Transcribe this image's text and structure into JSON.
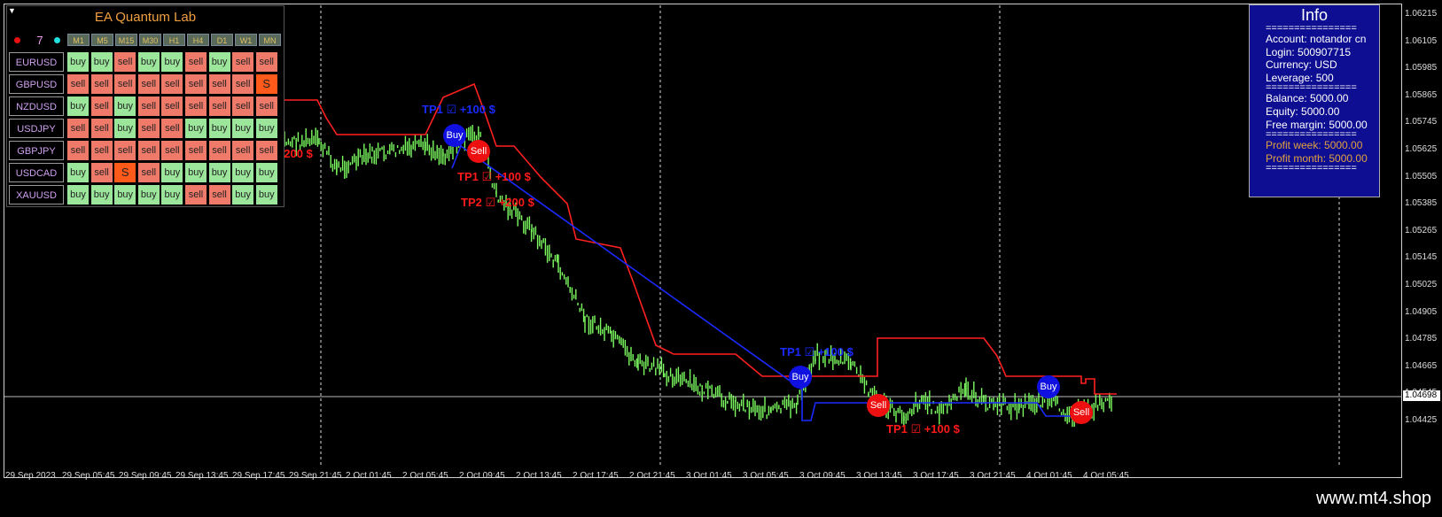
{
  "ea_panel": {
    "title": "EA Quantum Lab",
    "count": "7",
    "timeframes": [
      "M1",
      "M5",
      "M15",
      "M30",
      "H1",
      "H4",
      "D1",
      "W1",
      "MN"
    ],
    "pairs": [
      {
        "symbol": "EURUSD",
        "signals": [
          "buy",
          "buy",
          "sell",
          "buy",
          "buy",
          "sell",
          "buy",
          "sell",
          "sell"
        ]
      },
      {
        "symbol": "GBPUSD",
        "signals": [
          "sell",
          "sell",
          "sell",
          "sell",
          "sell",
          "sell",
          "sell",
          "sell",
          "S"
        ]
      },
      {
        "symbol": "NZDUSD",
        "signals": [
          "buy",
          "sell",
          "buy",
          "sell",
          "sell",
          "sell",
          "sell",
          "sell",
          "sell"
        ]
      },
      {
        "symbol": "USDJPY",
        "signals": [
          "sell",
          "sell",
          "buy",
          "sell",
          "sell",
          "buy",
          "buy",
          "buy",
          "buy"
        ]
      },
      {
        "symbol": "GBPJPY",
        "signals": [
          "sell",
          "sell",
          "sell",
          "sell",
          "sell",
          "sell",
          "sell",
          "sell",
          "sell"
        ]
      },
      {
        "symbol": "USDCAD",
        "signals": [
          "buy",
          "sell",
          "S",
          "sell",
          "buy",
          "buy",
          "buy",
          "buy",
          "buy"
        ]
      },
      {
        "symbol": "XAUUSD",
        "signals": [
          "buy",
          "buy",
          "buy",
          "buy",
          "buy",
          "sell",
          "sell",
          "buy",
          "buy"
        ]
      }
    ]
  },
  "info_panel": {
    "title": "Info",
    "separator": "================",
    "account": "Account: notandor cn",
    "login": "Login: 500907715",
    "currency": "Currency: USD",
    "leverage": "Leverage: 500",
    "balance": "Balance: 5000.00",
    "equity": "Equity: 5000.00",
    "free_margin": "Free margin: 5000.00",
    "profit_week": "Profit week: 5000.00",
    "profit_month": "Profit month: 5000.00"
  },
  "price_axis": [
    "1.06215",
    "1.06105",
    "1.05985",
    "1.05865",
    "1.05745",
    "1.05625",
    "1.05505",
    "1.05385",
    "1.05265",
    "1.05145",
    "1.05025",
    "1.04905",
    "1.04785",
    "1.04665",
    "1.04545",
    "1.04425"
  ],
  "current_price": "1.04698",
  "time_axis": [
    "29 Sep 2023",
    "29 Sep 05:45",
    "29 Sep 09:45",
    "29 Sep 13:45",
    "29 Sep 17:45",
    "29 Sep 21:45",
    "2 Oct 01:45",
    "2 Oct 05:45",
    "2 Oct 09:45",
    "2 Oct 13:45",
    "2 Oct 17:45",
    "2 Oct 21:45",
    "3 Oct 01:45",
    "3 Oct 05:45",
    "3 Oct 09:45",
    "3 Oct 13:45",
    "3 Oct 17:45",
    "3 Oct 21:45",
    "4 Oct 01:45",
    "4 Oct 05:45"
  ],
  "annotations": {
    "buy": "Buy",
    "sell": "Sell",
    "tp1_100": "TP1 ☑ +100 $",
    "tp2_200": "TP2 ☑ +200 $"
  },
  "colors": {
    "bull": "#7CFC60",
    "resistance": "#ff2020",
    "support": "#1a2aff",
    "buy_marker": "#1010e0",
    "sell_marker": "#ee1010"
  },
  "footer": {
    "brand": "www.mt4.shop"
  }
}
